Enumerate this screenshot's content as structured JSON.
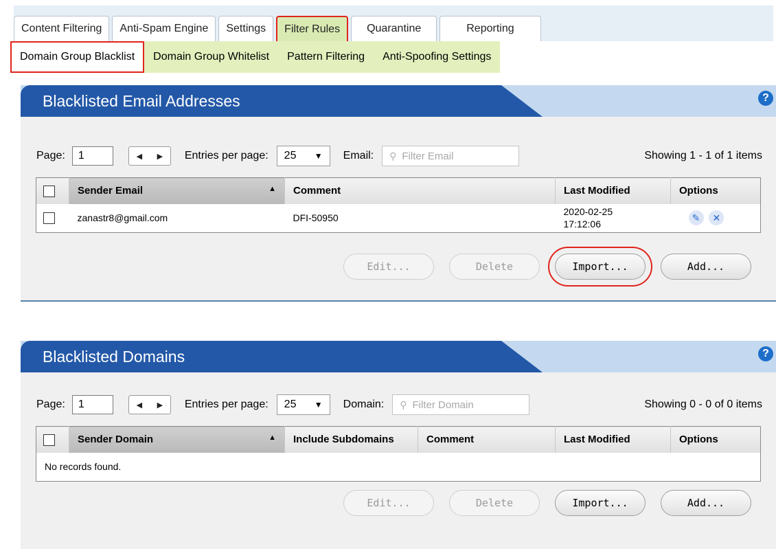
{
  "tabs": [
    {
      "label": "Content Filtering",
      "active": false
    },
    {
      "label": "Anti-Spam Engine",
      "active": false
    },
    {
      "label": "Settings",
      "active": false
    },
    {
      "label": "Filter Rules",
      "active": true
    },
    {
      "label": "Quarantine",
      "active": false
    },
    {
      "label": "Reporting",
      "active": false
    }
  ],
  "subtabs": [
    {
      "label": "Domain Group Blacklist",
      "active": true
    },
    {
      "label": "Domain Group Whitelist",
      "active": false
    },
    {
      "label": "Pattern Filtering",
      "active": false
    },
    {
      "label": "Anti-Spoofing Settings",
      "active": false
    }
  ],
  "emails_panel": {
    "title": "Blacklisted Email Addresses",
    "page_label": "Page:",
    "page_value": "1",
    "entries_label": "Entries per page:",
    "entries_value": "25",
    "filter_label": "Email:",
    "filter_placeholder": "Filter Email",
    "showing": "Showing 1 - 1 of 1 items",
    "columns": {
      "sender": "Sender Email",
      "comment": "Comment",
      "modified": "Last Modified",
      "options": "Options"
    },
    "rows": [
      {
        "sender": "zanastr8@gmail.com",
        "comment": "DFI-50950",
        "date": "2020-02-25",
        "time": "17:12:06"
      }
    ],
    "buttons": {
      "edit": "Edit...",
      "delete": "Delete",
      "import": "Import...",
      "add": "Add..."
    }
  },
  "domains_panel": {
    "title": "Blacklisted Domains",
    "page_label": "Page:",
    "page_value": "1",
    "entries_label": "Entries per page:",
    "entries_value": "25",
    "filter_label": "Domain:",
    "filter_placeholder": "Filter Domain",
    "showing": "Showing 0 - 0 of 0 items",
    "columns": {
      "sender": "Sender Domain",
      "subdomains": "Include Subdomains",
      "comment": "Comment",
      "modified": "Last Modified",
      "options": "Options"
    },
    "empty_text": "No records found.",
    "buttons": {
      "edit": "Edit...",
      "delete": "Delete",
      "import": "Import...",
      "add": "Add..."
    }
  },
  "icons": {
    "help": "help-circle-icon",
    "edit": "pencil-icon",
    "delete": "x-icon",
    "search": "magnifier-icon"
  },
  "colors": {
    "panel_title_bg": "#2358a8",
    "active_tab_bg": "#d9ebb2",
    "subtab_bg": "#e3f0bd",
    "highlight_red": "#e0241b"
  }
}
